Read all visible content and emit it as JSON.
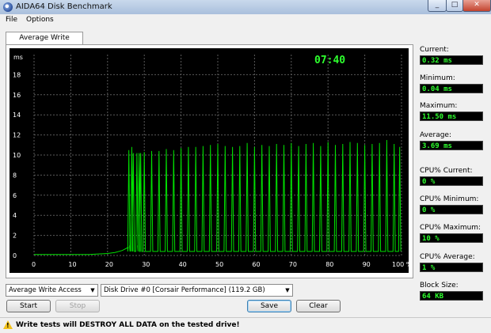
{
  "window": {
    "title": "AIDA64 Disk Benchmark",
    "minimize": "_",
    "maximize": "□",
    "close": "✕"
  },
  "menu": [
    "File",
    "Options"
  ],
  "tab": {
    "label": "Average Write Access"
  },
  "chart_data": {
    "type": "line",
    "title": "",
    "ylabel": "ms",
    "xlabel": "",
    "timer": "07:40",
    "ylim": [
      0,
      20
    ],
    "xlim": [
      0,
      100
    ],
    "yticks": [
      0,
      2,
      4,
      6,
      8,
      10,
      12,
      14,
      16,
      18
    ],
    "xticks": [
      "0",
      "10",
      "20",
      "30",
      "40",
      "50",
      "60",
      "70",
      "80",
      "90",
      "100 %"
    ],
    "grid": true,
    "series": [
      {
        "x": [
          0,
          5,
          10,
          15,
          20,
          22,
          24,
          25.6,
          25.8,
          26,
          26.6,
          26.8,
          27,
          28,
          28.2,
          28.6,
          29,
          30,
          32,
          34,
          36,
          38,
          40,
          42,
          44,
          46,
          48,
          50,
          52,
          54,
          56,
          58,
          60,
          62,
          64,
          66,
          68,
          70,
          72,
          74,
          76,
          78,
          80,
          82,
          84,
          86,
          88,
          90,
          92,
          94,
          96,
          98,
          99.5
        ],
        "y": [
          0.1,
          0.1,
          0.1,
          0.1,
          0.2,
          0.3,
          0.5,
          0.8,
          10.5,
          1,
          10.8,
          1,
          10.2,
          10.2,
          1,
          10.2,
          10.2,
          10.3,
          10.4,
          10.4,
          10.6,
          10.5,
          10.7,
          10.8,
          10.8,
          10.9,
          11,
          11.1,
          10.9,
          10.8,
          10.9,
          11.2,
          10.8,
          11,
          10.9,
          11.1,
          11,
          11.2,
          10.9,
          11.1,
          11.2,
          10.9,
          11.3,
          11,
          11.1,
          11.3,
          11.2,
          11,
          11.1,
          11.2,
          11.5,
          11.1,
          10.8
        ]
      }
    ]
  },
  "stats": [
    {
      "label": "Current:",
      "value": "0.32 ms"
    },
    {
      "label": "Minimum:",
      "value": "0.04 ms"
    },
    {
      "label": "Maximum:",
      "value": "11.50 ms"
    },
    {
      "label": "Average:",
      "value": "3.69 ms"
    },
    {
      "label": "CPU% Current:",
      "value": "0 %"
    },
    {
      "label": "CPU% Minimum:",
      "value": "0 %"
    },
    {
      "label": "CPU% Maximum:",
      "value": "10 %"
    },
    {
      "label": "CPU% Average:",
      "value": "1 %"
    },
    {
      "label": "Block Size:",
      "value": "64 KB"
    }
  ],
  "controls": {
    "test_select": "Average Write Access",
    "drive_select": "Disk Drive #0  [Corsair Performance]  (119.2 GB)",
    "start": "Start",
    "stop": "Stop",
    "save": "Save",
    "clear": "Clear"
  },
  "status": {
    "message": "Write tests will DESTROY ALL DATA on the tested drive!"
  },
  "colors": {
    "trace": "#00e000",
    "grid": "#5a5a5a",
    "axis_text": "#ffffff",
    "timer": "#2eff2e"
  }
}
